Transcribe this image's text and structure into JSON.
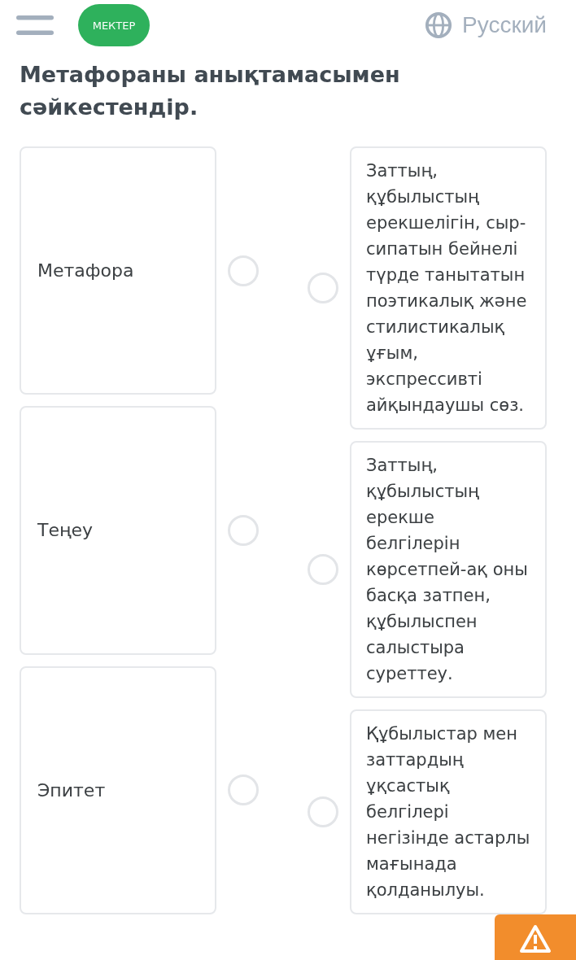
{
  "header": {
    "logo_text": "МЕКТЕР",
    "language": "Русский"
  },
  "title": "Метафораны анықтамасымен сәйкестендір.",
  "terms": [
    {
      "label": "Метафора",
      "selected": false
    },
    {
      "label": "Теңеу",
      "selected": false
    },
    {
      "label": "Эпитет",
      "selected": false
    }
  ],
  "definitions": [
    {
      "text": "Заттың, құбылыстың ерекшелігін, сыр-сипатын бейнелі түрде танытатын поэтикалық және стилистикалық ұғым, экспрессивті айқындаушы сөз.",
      "selected": false
    },
    {
      "text": "Заттың, құбылыстың ерекше белгілерін көрсетпей-ақ оны басқа затпен, құбылыспен салыстыра суреттеу.",
      "selected": false
    },
    {
      "text": "Құбылыстар мен заттардың ұқсастық белгілері негізінде астарлы мағынада қолданылуы.",
      "selected": false
    }
  ]
}
